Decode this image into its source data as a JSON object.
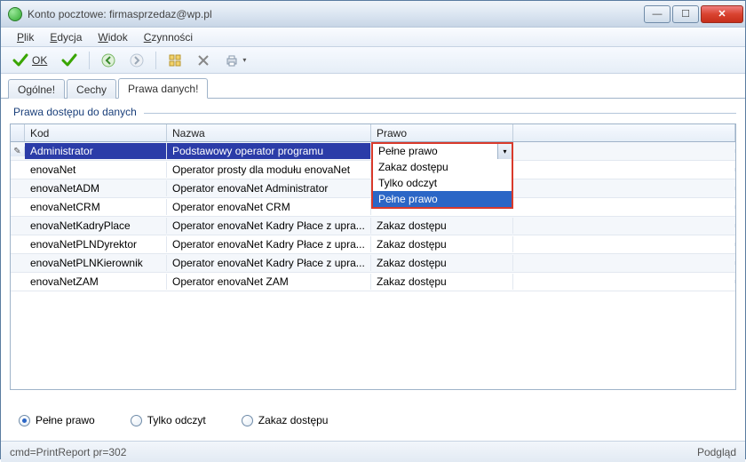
{
  "window": {
    "title": "Konto pocztowe: firmasprzedaz@wp.pl"
  },
  "menu": {
    "plik": "Plik",
    "edycja": "Edycja",
    "widok": "Widok",
    "czynnosci": "Czynności"
  },
  "toolbar": {
    "ok": "OK"
  },
  "tabs": {
    "ogolne": "Ogólne!",
    "cechy": "Cechy",
    "prawa": "Prawa danych!"
  },
  "group_label": "Prawa dostępu do danych",
  "columns": {
    "kod": "Kod",
    "nazwa": "Nazwa",
    "prawo": "Prawo"
  },
  "rows": [
    {
      "kod": "Administrator",
      "nazwa": "Podstawowy operator programu",
      "prawo": "Pełne prawo"
    },
    {
      "kod": "enovaNet",
      "nazwa": "Operator prosty dla modułu enovaNet",
      "prawo": ""
    },
    {
      "kod": "enovaNetADM",
      "nazwa": "Operator enovaNet Administrator",
      "prawo": ""
    },
    {
      "kod": "enovaNetCRM",
      "nazwa": "Operator enovaNet CRM",
      "prawo": ""
    },
    {
      "kod": "enovaNetKadryPlace",
      "nazwa": "Operator enovaNet Kadry Płace z upra...",
      "prawo": "Zakaz dostępu"
    },
    {
      "kod": "enovaNetPLNDyrektor",
      "nazwa": "Operator enovaNet Kadry Płace z upra...",
      "prawo": "Zakaz dostępu"
    },
    {
      "kod": "enovaNetPLNKierownik",
      "nazwa": "Operator enovaNet Kadry Płace z upra...",
      "prawo": "Zakaz dostępu"
    },
    {
      "kod": "enovaNetZAM",
      "nazwa": "Operator enovaNet ZAM",
      "prawo": "Zakaz dostępu"
    }
  ],
  "dropdown": {
    "current": "Pełne prawo",
    "options": [
      "Zakaz dostępu",
      "Tylko odczyt",
      "Pełne prawo"
    ],
    "selected": "Pełne prawo"
  },
  "radios": {
    "pelne": "Pełne prawo",
    "tylko": "Tylko odczyt",
    "zakaz": "Zakaz dostępu",
    "checked": "pelne"
  },
  "status": {
    "left": "cmd=PrintReport pr=302",
    "right": "Podgląd"
  }
}
